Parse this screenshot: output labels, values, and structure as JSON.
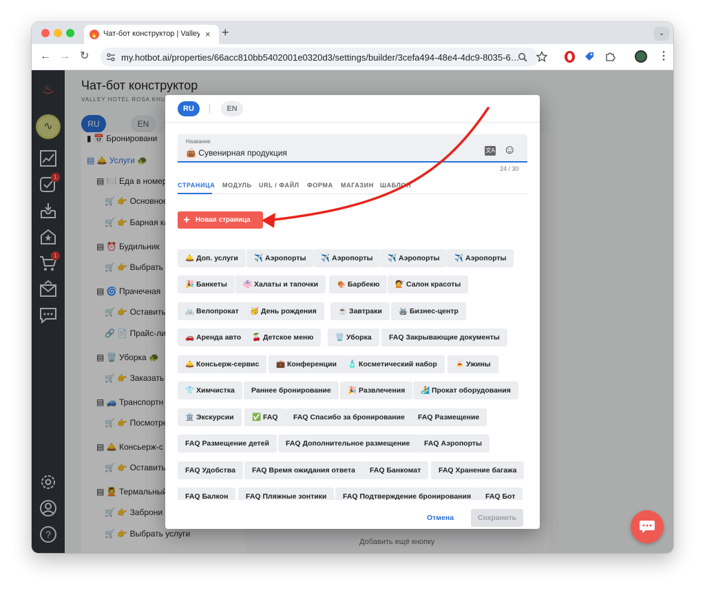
{
  "browser": {
    "tab_title": "Чат-бот конструктор | Valley",
    "tab_favicon": "🔥",
    "tab_close": "×",
    "new_tab": "+",
    "tab_menu": "⌄",
    "url": "my.hotbot.ai/properties/66acc810bb5402001e0320d3/settings/builder/3cefa494-48e4-4dc9-8035-6…",
    "nav": {
      "back": "←",
      "forward": "→",
      "reload": "↻"
    },
    "icons": [
      "zoom-icon",
      "star-icon",
      "opera-icon",
      "extension-tag-icon",
      "puzzle-icon",
      "profile-avatar",
      "menu-icon"
    ],
    "traffic_lights": [
      "#ff5f57",
      "#febc2e",
      "#28c840"
    ]
  },
  "sidebar": {
    "icons": [
      "flame-logo-icon",
      "profile-chart-icon",
      "analytics-icon",
      "tasks-icon",
      "inbox-icon",
      "hotel-icon",
      "cart-icon",
      "mail-icon",
      "chat-icon",
      "settings-icon",
      "account-icon",
      "help-icon"
    ],
    "tasks_badge": "1",
    "cart_badge": "1"
  },
  "page": {
    "title": "Чат-бот конструктор",
    "subtitle": "VALLEY HOTEL ROSA KHU",
    "lang_ru": "RU",
    "lang_en": "EN",
    "add_more": "Добавить ещё кнопку"
  },
  "tree": {
    "rows": [
      "Бронировани",
      "Услуги",
      "Еда в номер",
      "Основное",
      "Барная ка",
      "Будильник",
      "Выбрать",
      "Прачечная",
      "Оставить",
      "Прайс-ли",
      "Уборка",
      "Заказать",
      "Транспортн",
      "Посмотре",
      "Консьерж-с",
      "Оставить",
      "Термальный",
      "Заброни",
      "Выбрать услуги"
    ]
  },
  "modal": {
    "lang_ru": "RU",
    "lang_en": "EN",
    "name_label": "Название",
    "name_value": "👜 Сувенирная продукция",
    "counter": "24 / 30",
    "tabs": [
      "СТРАНИЦА",
      "МОДУЛЬ",
      "URL / ФАЙЛ",
      "ФОРМА",
      "МАГАЗИН",
      "ШАБЛОН"
    ],
    "new_page": "Новая страница",
    "chips": [
      "🛎️ Доп. услуги",
      "✈️ Аэропорты",
      "✈️ Аэропорты",
      "✈️ Аэропорты",
      "✈️ Аэропорты",
      "🎉 Банкеты",
      "👘 Халаты и тапочки",
      "🍖 Барбекю",
      "💇 Салон красоты",
      "🚲 Велопрокат",
      "🥳 День рождения",
      "☕ Завтраки",
      "🖨️ Бизнес-центр",
      "🚗 Аренда авто",
      "🍒 Детское меню",
      "🗑️ Уборка",
      "FAQ Закрывающие документы",
      "🛎️ Консьерж-сервис",
      "💼 Конференции",
      "🧴 Косметический набор",
      "🍝 Ужины",
      "👕 Химчистка",
      "Раннее бронирование",
      "🎉 Развлечения",
      "🏄 Прокат оборудования",
      "🏛️ Экскурсии",
      "✅ FAQ",
      "FAQ Спасибо за бронирование",
      "FAQ Размещение",
      "FAQ Размещение детей",
      "FAQ Дополнительное размещение",
      "FAQ Аэропорты",
      "FAQ Удобства",
      "FAQ Время ожидания ответа",
      "FAQ Банкомат",
      "FAQ Хранение багажа",
      "FAQ Балкон",
      "FAQ Пляжные зонтики",
      "FAQ Подтверждение бронирования",
      "FAQ Бот"
    ],
    "cancel": "Отмена",
    "save": "Сохранить"
  },
  "colors": {
    "accent_blue": "#2a6fd6",
    "new_page_red": "#f25c52",
    "annotation_arrow": "#e8231b",
    "sidebar_dark": "#33373d"
  }
}
